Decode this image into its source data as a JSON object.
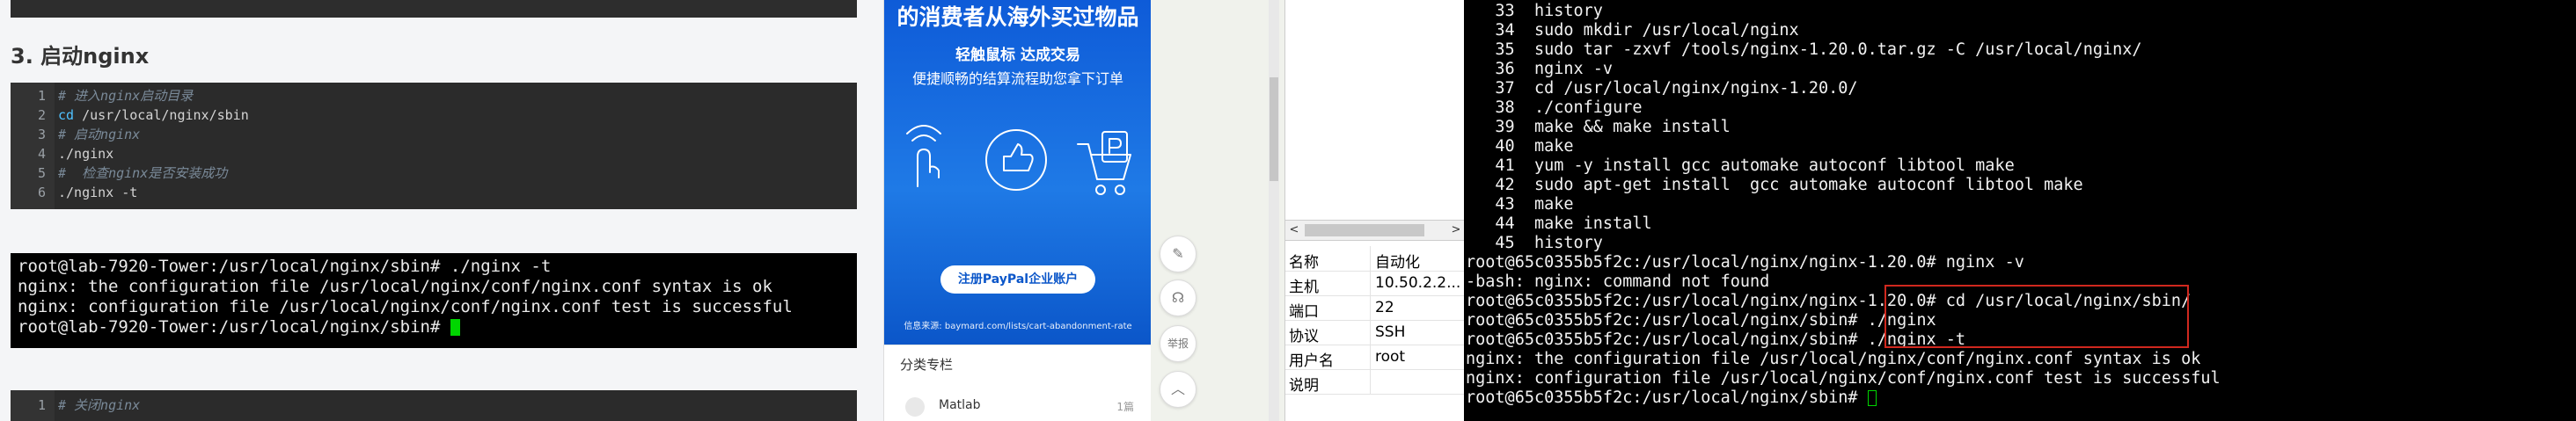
{
  "article": {
    "section_title": "3. 启动nginx",
    "code_block_1": [
      {
        "num": "1",
        "text": "# 进入nginx启动目录",
        "kind": "comment"
      },
      {
        "num": "2",
        "kw": "cd",
        "text": " /usr/local/nginx/sbin",
        "kind": "cmd"
      },
      {
        "num": "3",
        "text": "# 启动nginx",
        "kind": "comment"
      },
      {
        "num": "4",
        "text": "./nginx",
        "kind": "plain"
      },
      {
        "num": "5",
        "text": "#  检查nginx是否安装成功",
        "kind": "comment"
      },
      {
        "num": "6",
        "text": "./nginx -t",
        "kind": "plain"
      }
    ],
    "terminal_screenshot": [
      "root@lab-7920-Tower:/usr/local/nginx/sbin# ./nginx -t",
      "nginx: the configuration file /usr/local/nginx/conf/nginx.conf syntax is ok",
      "nginx: configuration file /usr/local/nginx/conf/nginx.conf test is successful",
      "root@lab-7920-Tower:/usr/local/nginx/sbin# "
    ],
    "code_block_2_first_line": {
      "num": "1",
      "text": "# 关闭nginx"
    }
  },
  "ad": {
    "headline": "的消费者从海外买过物品",
    "sub1": "轻触鼠标 达成交易",
    "sub2": "便捷顺畅的结算流程助您拿下订单",
    "cta": "注册PayPal企业账户",
    "source": "信息来源: baymard.com/lists/cart-abandonment-rate",
    "category_header": "分类专栏",
    "category_item": {
      "label": "Matlab",
      "count": "1篇"
    }
  },
  "float_buttons": [
    {
      "name": "edit-icon",
      "glyph": "✎"
    },
    {
      "name": "headset-icon",
      "glyph": "☊"
    },
    {
      "name": "report-icon",
      "glyph": "举报"
    },
    {
      "name": "back-to-top-icon",
      "glyph": "︿"
    }
  ],
  "session_info": {
    "scroll_left": "<",
    "scroll_right": ">",
    "rows": [
      {
        "key": "名称",
        "value": "自动化"
      },
      {
        "key": "主机",
        "value": "10.50.2.2..."
      },
      {
        "key": "端口",
        "value": "22"
      },
      {
        "key": "协议",
        "value": "SSH"
      },
      {
        "key": "用户名",
        "value": "root"
      },
      {
        "key": "说明",
        "value": ""
      }
    ]
  },
  "terminal": {
    "lines": [
      "   33  history",
      "   34  sudo mkdir /usr/local/nginx",
      "   35  sudo tar -zxvf /tools/nginx-1.20.0.tar.gz -C /usr/local/nginx/",
      "   36  nginx -v",
      "   37  cd /usr/local/nginx/nginx-1.20.0/",
      "   38  ./configure",
      "   39  make && make install",
      "   40  make",
      "   41  yum -y install gcc automake autoconf libtool make",
      "   42  sudo apt-get install  gcc automake autoconf libtool make",
      "   43  make",
      "   44  make install",
      "   45  history",
      "root@65c0355b5f2c:/usr/local/nginx/nginx-1.20.0# nginx -v",
      "-bash: nginx: command not found",
      "root@65c0355b5f2c:/usr/local/nginx/nginx-1.20.0# cd /usr/local/nginx/sbin/",
      "root@65c0355b5f2c:/usr/local/nginx/sbin# ./nginx",
      "root@65c0355b5f2c:/usr/local/nginx/sbin# ./nginx -t",
      "nginx: the configuration file /usr/local/nginx/conf/nginx.conf syntax is ok",
      "nginx: configuration file /usr/local/nginx/conf/nginx.conf test is successful",
      "root@65c0355b5f2c:/usr/local/nginx/sbin# "
    ],
    "highlight_color": "#d0281e",
    "cursor_color": "#00d600"
  }
}
